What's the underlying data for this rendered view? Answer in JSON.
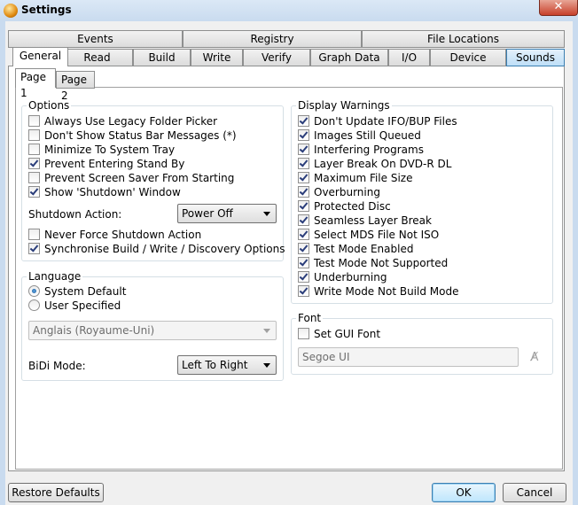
{
  "window": {
    "title": "Settings",
    "close_glyph": "✕"
  },
  "tabs_row1": [
    "Events",
    "Registry",
    "File Locations"
  ],
  "tabs_row2": [
    "General",
    "Read",
    "Build",
    "Write",
    "Verify",
    "Graph Data",
    "I/O",
    "Device",
    "Sounds"
  ],
  "active_tab": "General",
  "page_tabs": [
    "Page 1",
    "Page 2"
  ],
  "options": {
    "title": "Options",
    "items": [
      {
        "label": "Always Use Legacy Folder Picker",
        "checked": false
      },
      {
        "label": "Don't Show Status Bar Messages (*)",
        "checked": false
      },
      {
        "label": "Minimize To System Tray",
        "checked": false
      },
      {
        "label": "Prevent Entering Stand By",
        "checked": true
      },
      {
        "label": "Prevent Screen Saver From Starting",
        "checked": false
      },
      {
        "label": "Show 'Shutdown' Window",
        "checked": true
      }
    ],
    "shutdown_label": "Shutdown Action:",
    "shutdown_value": "Power Off",
    "extra_items": [
      {
        "label": "Never Force Shutdown Action",
        "checked": false
      },
      {
        "label": "Synchronise Build / Write / Discovery Options",
        "checked": true
      }
    ]
  },
  "language": {
    "title": "Language",
    "system_default": "System Default",
    "user_specified": "User Specified",
    "selected": "System Default",
    "language_value": "Anglais (Royaume-Uni)",
    "bidi_label": "BiDi Mode:",
    "bidi_value": "Left To Right"
  },
  "display_warnings": {
    "title": "Display Warnings",
    "items": [
      {
        "label": "Don't Update IFO/BUP Files",
        "checked": true
      },
      {
        "label": "Images Still Queued",
        "checked": true
      },
      {
        "label": "Interfering Programs",
        "checked": true
      },
      {
        "label": "Layer Break On DVD-R DL",
        "checked": true
      },
      {
        "label": "Maximum File Size",
        "checked": true
      },
      {
        "label": "Overburning",
        "checked": true
      },
      {
        "label": "Protected Disc",
        "checked": true
      },
      {
        "label": "Seamless Layer Break",
        "checked": true
      },
      {
        "label": "Select MDS File Not ISO",
        "checked": true
      },
      {
        "label": "Test Mode Enabled",
        "checked": true
      },
      {
        "label": "Test Mode Not Supported",
        "checked": true
      },
      {
        "label": "Underburning",
        "checked": true
      },
      {
        "label": "Write Mode Not Build Mode",
        "checked": true
      }
    ]
  },
  "font": {
    "title": "Font",
    "set_gui_font": "Set GUI Font",
    "set_gui_font_checked": false,
    "font_value": "Segoe UI"
  },
  "buttons": {
    "restore": "Restore Defaults",
    "ok": "OK",
    "cancel": "Cancel"
  }
}
